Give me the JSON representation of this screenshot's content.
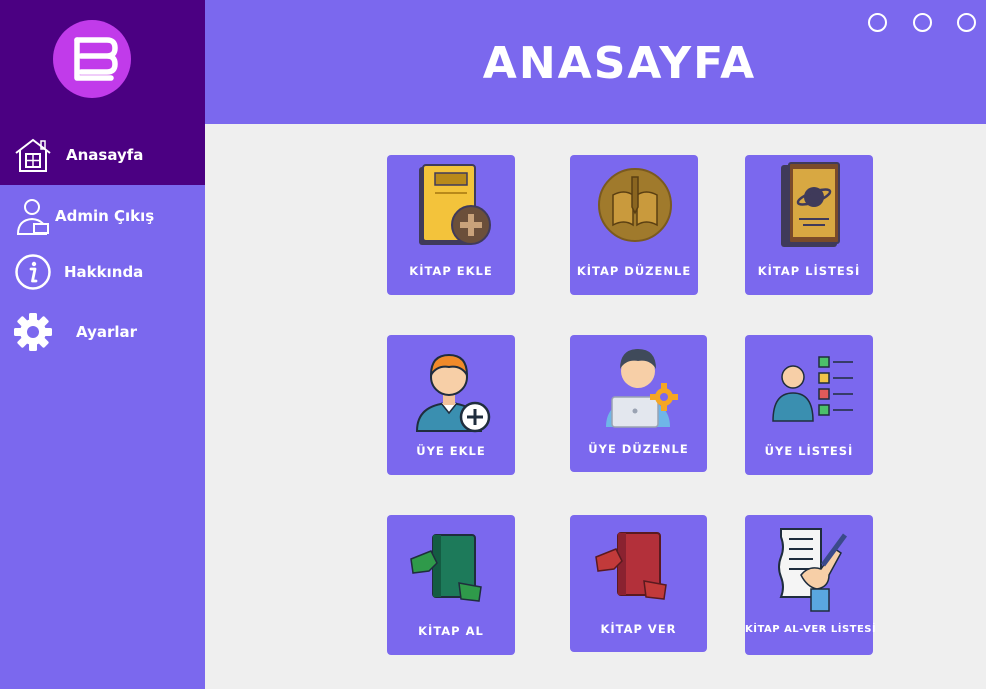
{
  "sidebar": {
    "items": [
      {
        "label": "Anasayfa",
        "icon": "home-icon"
      },
      {
        "label": "Admin Çıkış",
        "icon": "admin-logout-icon"
      },
      {
        "label": "Hakkında",
        "icon": "info-icon"
      },
      {
        "label": "Ayarlar",
        "icon": "gear-icon"
      }
    ]
  },
  "header": {
    "title": "ANASAYFA"
  },
  "tiles": [
    {
      "label": "KİTAP EKLE"
    },
    {
      "label": "KİTAP DÜZENLE"
    },
    {
      "label": "KİTAP LİSTESİ"
    },
    {
      "label": "ÜYE EKLE"
    },
    {
      "label": "ÜYE DÜZENLE"
    },
    {
      "label": "ÜYE LİSTESİ"
    },
    {
      "label": "KİTAP AL"
    },
    {
      "label": "KİTAP VER"
    },
    {
      "label": "KİTAP AL-VER LİSTESİ"
    }
  ],
  "colors": {
    "sidebar": "#7b68ee",
    "sidebar_dark": "#4b0082",
    "content_bg": "#efefef",
    "logo": "#c13bea"
  }
}
